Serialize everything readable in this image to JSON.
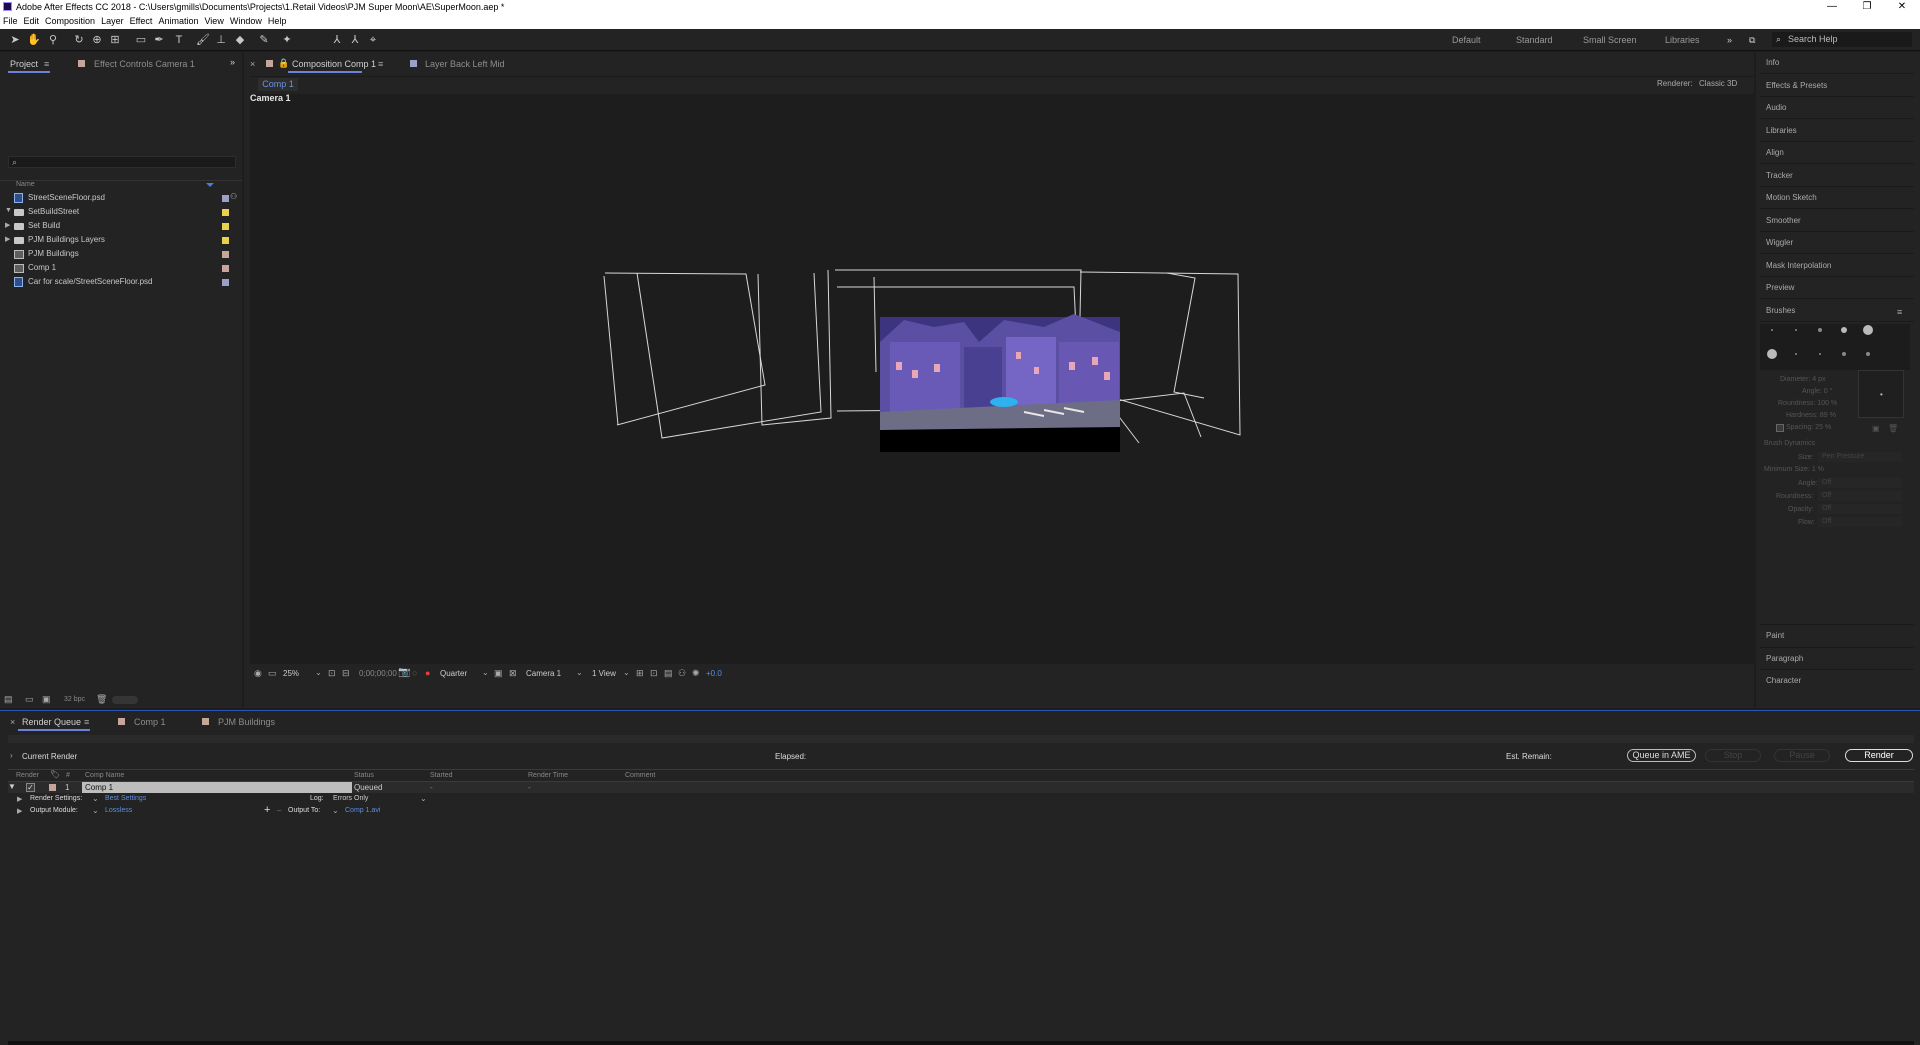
{
  "window": {
    "title": "Adobe After Effects CC 2018 - C:\\Users\\gmills\\Documents\\Projects\\1.Retail Videos\\PJM Super Moon\\AE\\SuperMoon.aep *"
  },
  "menu": [
    "File",
    "Edit",
    "Composition",
    "Layer",
    "Effect",
    "Animation",
    "View",
    "Window",
    "Help"
  ],
  "workspaces": [
    "Default",
    "Standard",
    "Small Screen",
    "Libraries"
  ],
  "search_help": "Search Help",
  "left_tabs": {
    "project": "Project",
    "effect_controls": "Effect Controls Camera 1"
  },
  "project": {
    "name_header": "Name",
    "items": [
      {
        "name": "StreetSceneFloor.psd",
        "type": "psd",
        "color": "#9aa0c8",
        "expand": ""
      },
      {
        "name": "SetBuildStreet",
        "type": "folder",
        "color": "#e8d14f",
        "expand": "▼"
      },
      {
        "name": "Set Build",
        "type": "folder",
        "color": "#e8d14f",
        "expand": "▶"
      },
      {
        "name": "PJM Buildings Layers",
        "type": "folder",
        "color": "#e8d14f",
        "expand": "▶"
      },
      {
        "name": "PJM Buildings",
        "type": "comp",
        "color": "#c6a59b",
        "expand": ""
      },
      {
        "name": "Comp 1",
        "type": "comp",
        "color": "#c6a59b",
        "expand": ""
      },
      {
        "name": "Car for scale/StreetSceneFloor.psd",
        "type": "psd",
        "color": "#9aa0c8",
        "expand": ""
      }
    ],
    "bpc": "32 bpc"
  },
  "comp": {
    "tab_label": "Composition Comp 1",
    "layer_tab": "Layer Back Left Mid",
    "subtab": "Comp 1",
    "renderer_label": "Renderer:",
    "renderer_value": "Classic 3D",
    "active_camera": "Camera 1"
  },
  "viewer_bar": {
    "zoom": "25%",
    "timecode": "0;00;00;00",
    "resolution": "Quarter",
    "camera": "Camera 1",
    "views": "1 View",
    "exposure": "+0.0"
  },
  "right_panels": [
    "Info",
    "Effects & Presets",
    "Audio",
    "Libraries",
    "Align",
    "Tracker",
    "Motion Sketch",
    "Smoother",
    "Wiggler",
    "Mask Interpolation",
    "Preview",
    "Brushes"
  ],
  "right_panels_bottom": [
    "Paint",
    "Paragraph",
    "Character"
  ],
  "brushes": {
    "diameter": "Diameter: 4 px",
    "angle": "Angle: 0 °",
    "roundness": "Roundness: 100 %",
    "hardness": "Hardness: 89 %",
    "spacing": "Spacing: 25 %",
    "dynamics": "Brush Dynamics",
    "size_label": "Size:",
    "size_value": "Pen Pressure",
    "min_size": "Minimum Size: 1 %",
    "dyn_angle": "Angle:",
    "dyn_roundness": "Roundness:",
    "dyn_opacity": "Opacity:",
    "dyn_flow": "Flow:",
    "off": "Off"
  },
  "bottom_tabs": [
    "Render Queue",
    "Comp 1",
    "PJM Buildings"
  ],
  "render_queue": {
    "current_render": "Current Render",
    "elapsed": "Elapsed:",
    "est_remain": "Est. Remain:",
    "queue_ame": "Queue in AME",
    "stop": "Stop",
    "pause": "Pause",
    "render": "Render",
    "headers": {
      "render": "Render",
      "num": "#",
      "comp": "Comp Name",
      "status": "Status",
      "started": "Started",
      "render_time": "Render Time",
      "comment": "Comment"
    },
    "row": {
      "num": "1",
      "comp": "Comp 1",
      "status": "Queued",
      "started": "-",
      "render_time": "-"
    },
    "render_settings_label": "Render Settings:",
    "render_settings_value": "Best Settings",
    "log_label": "Log:",
    "log_value": "Errors Only",
    "output_module_label": "Output Module:",
    "output_module_value": "Lossless",
    "output_to_label": "Output To:",
    "output_to_value": "Comp 1.avi"
  }
}
